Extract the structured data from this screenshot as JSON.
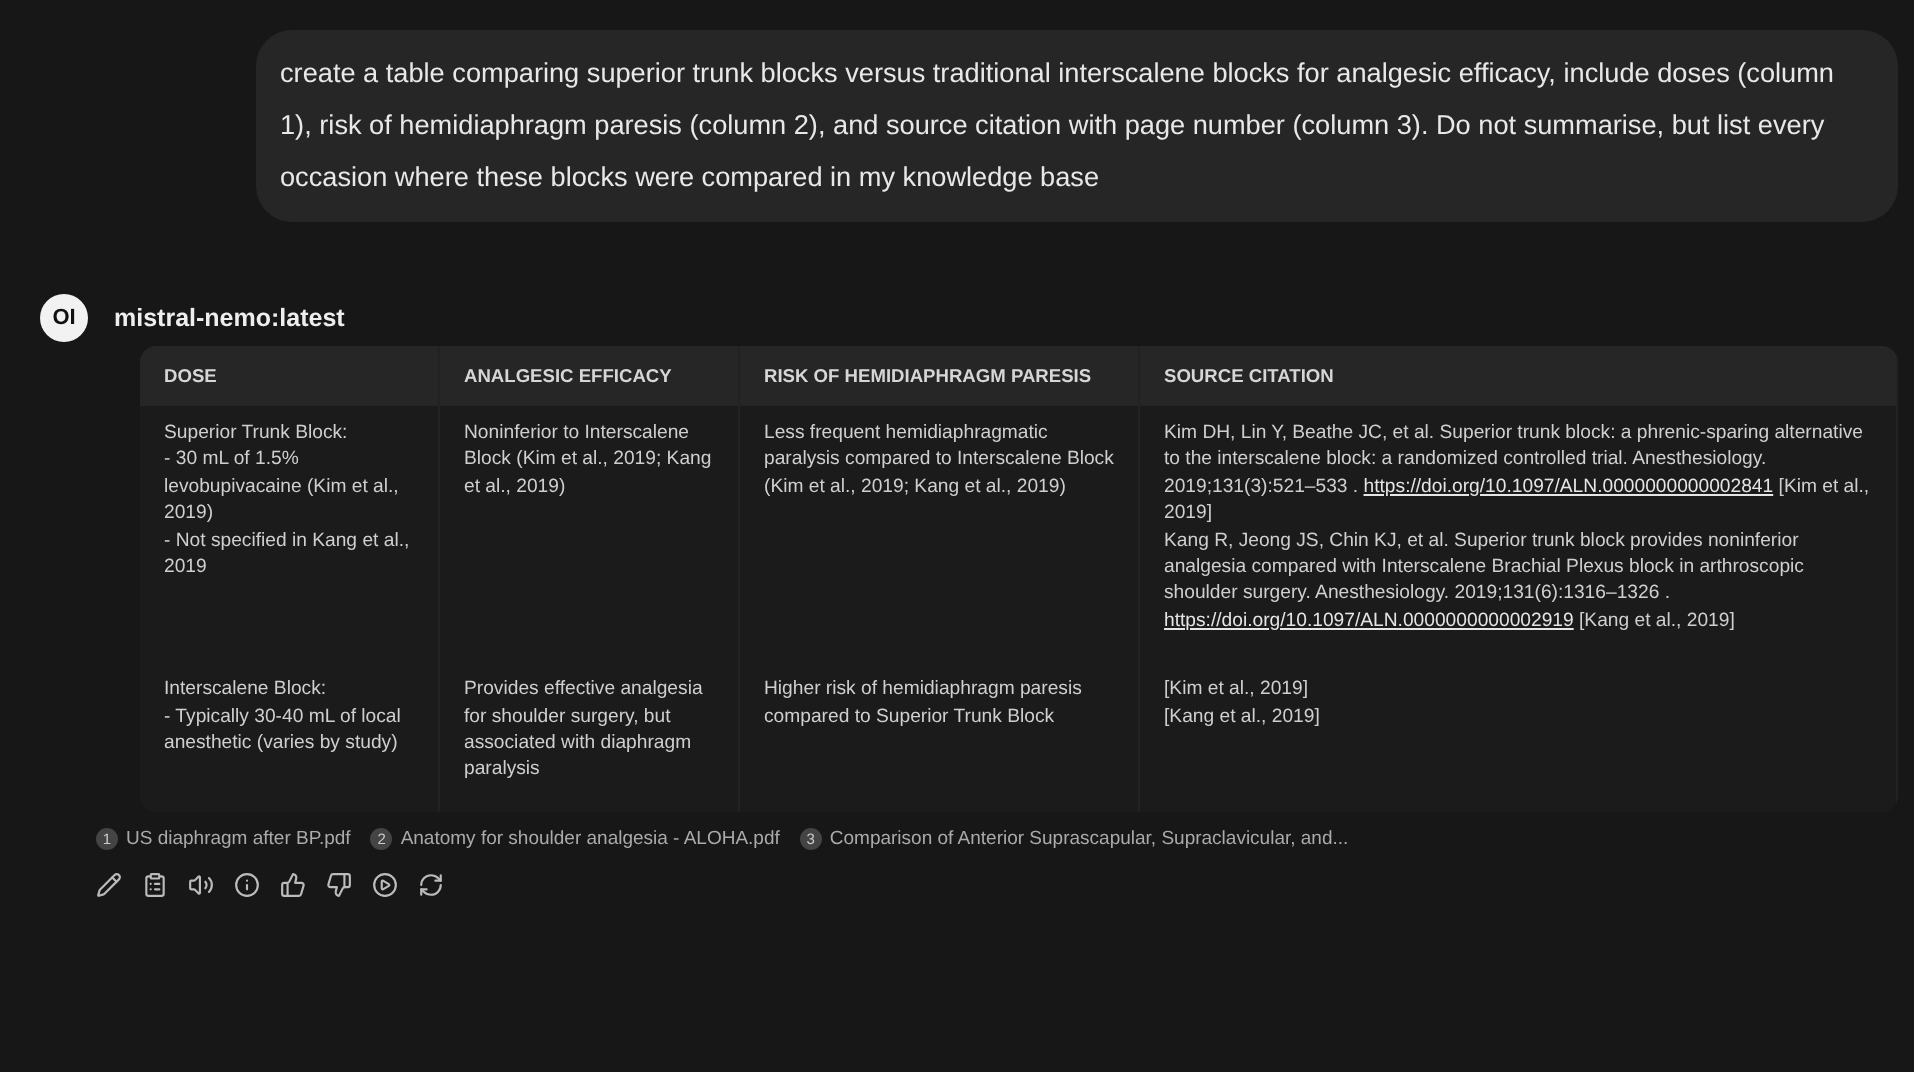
{
  "prompt": "create a table comparing superior trunk blocks versus traditional interscalene blocks for analgesic efficacy, include doses (column 1), risk of hemidiaphragm paresis (column 2), and source citation with page number (column 3). Do not summarise, but list every occasion where these blocks were compared in my knowledge base",
  "assistant": {
    "avatar": "OI",
    "model": "mistral-nemo:latest"
  },
  "table": {
    "columns": [
      "DOSE",
      "ANALGESIC EFFICACY",
      "RISK OF HEMIDIAPHRAGM PARESIS",
      "SOURCE CITATION"
    ],
    "rows": [
      [
        [
          {
            "kind": "text",
            "text": "Superior Trunk Block:\n- 30 mL of 1.5% levobupivacaine (Kim et al., 2019)\n- Not specified in Kang et al., 2019"
          }
        ],
        [
          {
            "kind": "text",
            "text": "Noninferior to Interscalene Block (Kim et al., 2019; Kang et al., 2019)"
          }
        ],
        [
          {
            "kind": "text",
            "text": "Less frequent hemidiaphragmatic paralysis compared to Interscalene Block (Kim et al., 2019; Kang et al., 2019)"
          }
        ],
        [
          {
            "kind": "text",
            "text": "Kim DH, Lin Y, Beathe JC, et al. Superior trunk block: a phrenic-sparing alternative to the interscalene block: a randomized controlled trial. Anesthesiology. 2019;131(3):521–533 . "
          },
          {
            "kind": "link",
            "text": "https://doi.org/10.1097/ALN.0000000000002841"
          },
          {
            "kind": "text",
            "text": " [Kim et al., 2019]\nKang R, Jeong JS, Chin KJ, et al. Superior trunk block provides noninferior analgesia compared with Interscalene Brachial Plexus block in arthroscopic shoulder surgery. Anesthesiology. 2019;131(6):1316–1326 . "
          },
          {
            "kind": "link",
            "text": "https://doi.org/10.1097/ALN.0000000000002919"
          },
          {
            "kind": "text",
            "text": " [Kang et al., 2019]"
          }
        ]
      ],
      [
        [
          {
            "kind": "text",
            "text": "Interscalene Block:\n- Typically 30-40 mL of local anesthetic (varies by study)"
          }
        ],
        [
          {
            "kind": "text",
            "text": "Provides effective analgesia for shoulder surgery, but associated with diaphragm paralysis"
          }
        ],
        [
          {
            "kind": "text",
            "text": "Higher risk of hemidiaphragm paresis compared to Superior Trunk Block"
          }
        ],
        [
          {
            "kind": "text",
            "text": "[Kim et al., 2019]\n[Kang et al., 2019]"
          }
        ]
      ]
    ]
  },
  "sources": [
    {
      "number": "1",
      "name": "US diaphragm after BP.pdf"
    },
    {
      "number": "2",
      "name": "Anatomy for shoulder analgesia - ALOHA.pdf"
    },
    {
      "number": "3",
      "name": "Comparison of Anterior Suprascapular, Supraclavicular, and..."
    }
  ],
  "actions": [
    {
      "kind": "edit"
    },
    {
      "kind": "copy"
    },
    {
      "kind": "speak"
    },
    {
      "kind": "info"
    },
    {
      "kind": "good"
    },
    {
      "kind": "bad"
    },
    {
      "kind": "continue"
    },
    {
      "kind": "regenerate"
    }
  ]
}
